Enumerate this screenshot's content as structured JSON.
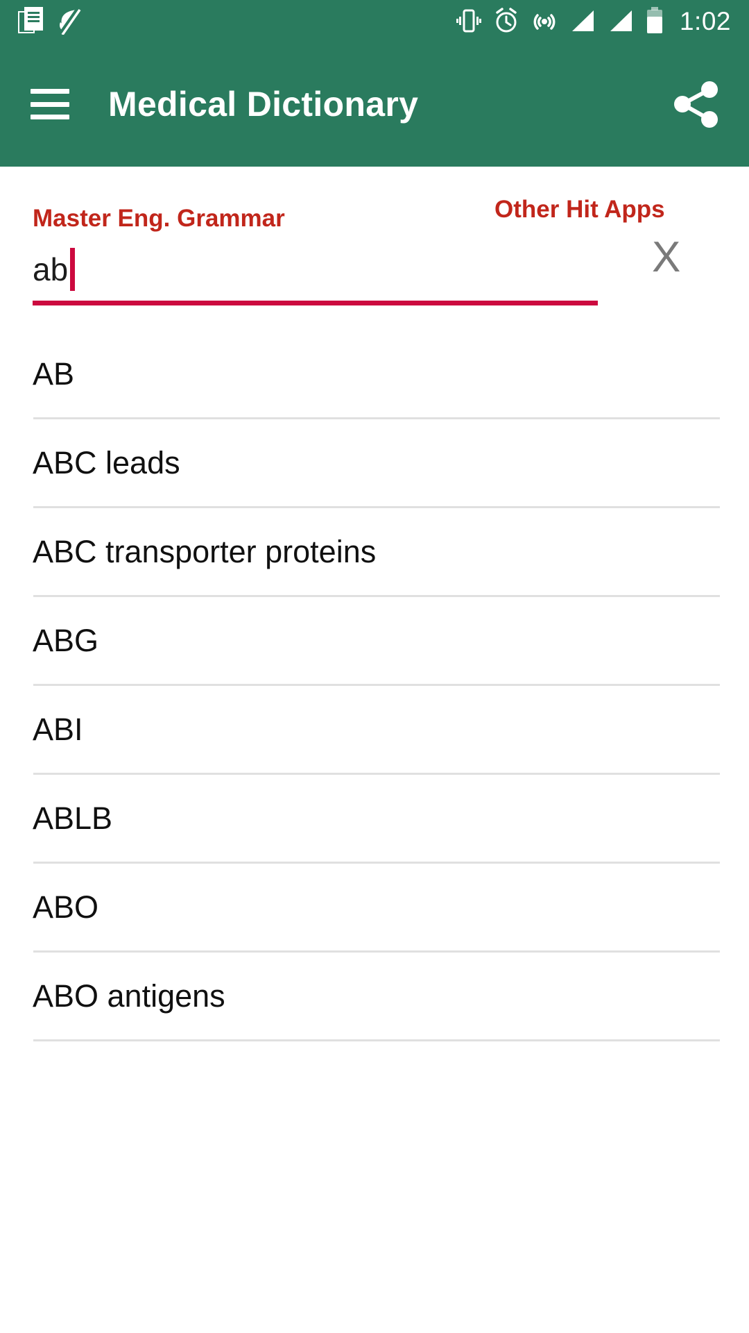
{
  "colors": {
    "brand_green": "#2A7B5E",
    "accent_red": "#C1261B",
    "accent_crimson": "#CC0A3F",
    "divider": "#E0E0E0",
    "clear_gray": "#7a7a7a"
  },
  "status_bar": {
    "time": "1:02",
    "left_icons": [
      "news-document-icon",
      "leaf-muted-icon"
    ],
    "right_icons": [
      "vibrate-icon",
      "alarm-clock-icon",
      "hotspot-icon",
      "signal-bars-icon-1",
      "signal-bars-icon-2",
      "battery-icon"
    ]
  },
  "app_bar": {
    "menu_icon": "hamburger-menu-icon",
    "title": "Medical Dictionary",
    "share_icon": "share-icon"
  },
  "promo": {
    "left_label": "Master Eng. Grammar",
    "right_label": "Other Hit Apps"
  },
  "search": {
    "value": "ab",
    "placeholder": "",
    "clear_label": "X",
    "clear_icon": "close-icon"
  },
  "results": {
    "items": [
      {
        "label": "AB"
      },
      {
        "label": "ABC leads"
      },
      {
        "label": "ABC transporter proteins"
      },
      {
        "label": "ABG"
      },
      {
        "label": "ABI"
      },
      {
        "label": "ABLB"
      },
      {
        "label": "ABO"
      },
      {
        "label": "ABO antigens"
      }
    ]
  }
}
